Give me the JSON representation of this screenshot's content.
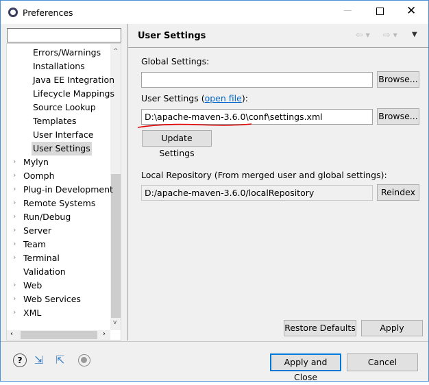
{
  "window": {
    "title": "Preferences"
  },
  "filter": {
    "value": ""
  },
  "tree": {
    "items": [
      {
        "label": "Errors/Warnings",
        "level": 2,
        "selected": false
      },
      {
        "label": "Installations",
        "level": 2,
        "selected": false
      },
      {
        "label": "Java EE Integration",
        "level": 2,
        "selected": false
      },
      {
        "label": "Lifecycle Mappings",
        "level": 2,
        "selected": false
      },
      {
        "label": "Source Lookup",
        "level": 2,
        "selected": false
      },
      {
        "label": "Templates",
        "level": 2,
        "selected": false
      },
      {
        "label": "User Interface",
        "level": 2,
        "selected": false
      },
      {
        "label": "User Settings",
        "level": 2,
        "selected": true
      },
      {
        "label": "Mylyn",
        "level": 1,
        "expandable": true
      },
      {
        "label": "Oomph",
        "level": 1,
        "expandable": true
      },
      {
        "label": "Plug-in Development",
        "level": 1,
        "expandable": true
      },
      {
        "label": "Remote Systems",
        "level": 1,
        "expandable": true
      },
      {
        "label": "Run/Debug",
        "level": 1,
        "expandable": true
      },
      {
        "label": "Server",
        "level": 1,
        "expandable": true
      },
      {
        "label": "Team",
        "level": 1,
        "expandable": true
      },
      {
        "label": "Terminal",
        "level": 1,
        "expandable": true
      },
      {
        "label": "Validation",
        "level": 1,
        "expandable": false
      },
      {
        "label": "Web",
        "level": 1,
        "expandable": true
      },
      {
        "label": "Web Services",
        "level": 1,
        "expandable": true
      },
      {
        "label": "XML",
        "level": 1,
        "expandable": true
      }
    ]
  },
  "page": {
    "title": "User Settings",
    "global_label": "Global Settings:",
    "global_value": "",
    "browse": "Browse...",
    "user_label_prefix": "User Settings (",
    "user_link": "open file",
    "user_label_suffix": "):",
    "user_value": "D:\\apache-maven-3.6.0\\conf\\settings.xml",
    "update": "Update Settings",
    "local_label": "Local Repository (From merged user and global settings):",
    "local_value": "D:/apache-maven-3.6.0/localRepository",
    "reindex": "Reindex",
    "restore": "Restore Defaults",
    "apply": "Apply"
  },
  "footer": {
    "apply_close": "Apply and Close",
    "cancel": "Cancel"
  },
  "colors": {
    "accent": "#0078d7",
    "annotation": "#e00000"
  }
}
